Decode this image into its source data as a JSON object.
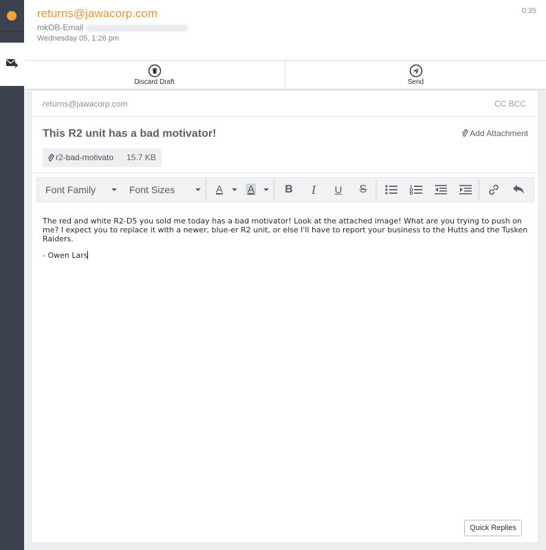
{
  "header": {
    "from_email": "returns@jawacorp.com",
    "account_label": "mkOB-Email",
    "date": "Wednesday 05, 1:26 pm",
    "time": "0:35"
  },
  "actions": {
    "discard_label": "Discard Draft",
    "send_label": "Send"
  },
  "compose": {
    "to": "returns@jawacorp.com",
    "cc_bcc": "CC BCC",
    "subject": "This R2 unit has a bad motivator!",
    "add_attachment": "Add Attachment",
    "attachment": {
      "name": "r2-bad-motivato",
      "size": "15.7 KB"
    },
    "body": {
      "paragraph": "The red and white R2-D5 you sold me today has a bad motivator! Look at the attached image! What are you trying to push on me? I expect you to replace it with a newer, blue-er R2 unit, or else I'll have to report your business to the Hutts and the Tusken Raiders.",
      "signature": "- Owen Lars"
    },
    "quick_replies": "Quick Replies"
  },
  "toolbar": {
    "font_family": "Font Family",
    "font_sizes": "Font Sizes",
    "text_color_glyph": "A",
    "highlight_glyph": "A",
    "bold_glyph": "B",
    "italic_glyph": "I",
    "underline_glyph": "U",
    "strike_glyph": "S"
  },
  "colors": {
    "accent": "#f0932b",
    "status_dot": "#f5a331",
    "rail": "#3c4250"
  }
}
